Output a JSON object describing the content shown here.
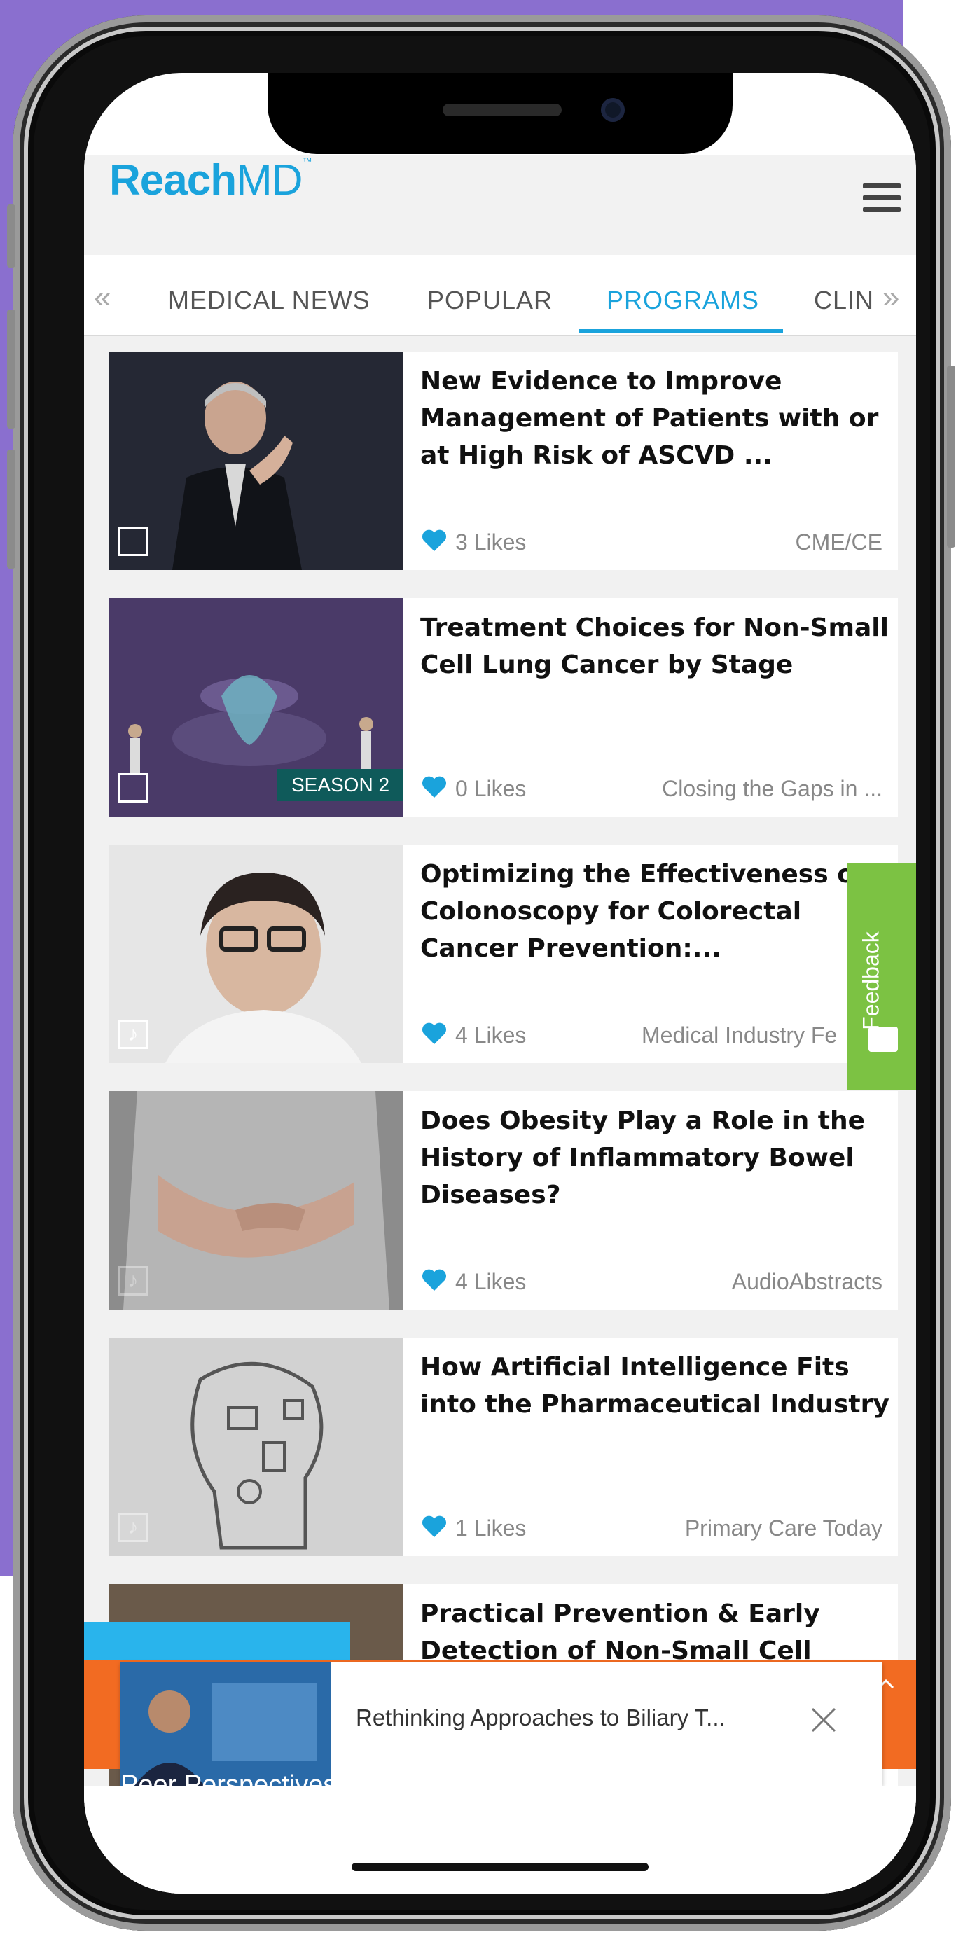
{
  "app": {
    "logo_reach": "Reach",
    "logo_md": "MD"
  },
  "nav": {
    "tabs": [
      {
        "label": "MEDICAL NEWS",
        "active": false
      },
      {
        "label": "POPULAR",
        "active": false
      },
      {
        "label": "PROGRAMS",
        "active": true
      },
      {
        "label": "CLIN",
        "active": false
      }
    ],
    "prev_icon": "double-chevron-left-icon",
    "next_icon": "double-chevron-right-icon"
  },
  "colors": {
    "accent": "#1aa3dc",
    "feedback": "#7cc243",
    "banner": "#f26b22",
    "background": "#8a6fcf"
  },
  "cards": [
    {
      "title": "New Evidence to Improve Management of Patients with or at High Risk of ASCVD ...",
      "likes": "3  Likes",
      "source": "CME/CE",
      "media": "video-icon"
    },
    {
      "title": "Treatment Choices for Non-Small Cell Lung Cancer by Stage",
      "likes": "0  Likes",
      "source": "Closing the Gaps in ...",
      "media": "video-icon",
      "badge": "SEASON 2"
    },
    {
      "title": "Optimizing the Effectiveness of Colonoscopy for Colorectal Cancer Prevention:...",
      "likes": "4  Likes",
      "source": "Medical Industry Fe",
      "media": "music-note-icon"
    },
    {
      "title": "Does Obesity Play a Role in the History of Inflammatory Bowel Diseases?",
      "likes": "4  Likes",
      "source": "AudioAbstracts",
      "media": "music-note-icon"
    },
    {
      "title": "How Artificial Intelligence Fits into the Pharmaceutical Industry",
      "likes": "1  Likes",
      "source": "Primary Care Today",
      "media": "music-note-icon"
    },
    {
      "title": "Practical Prevention & Early Detection of Non-Small Cell",
      "likes": "",
      "source": "",
      "media": ""
    }
  ],
  "feedback": {
    "label": "Feedback"
  },
  "player": {
    "title": "Rethinking Approaches to Biliary T..."
  },
  "banner": {
    "text": "Peer Perspectives: Evolving Treatment in Diabetes to Incor"
  }
}
